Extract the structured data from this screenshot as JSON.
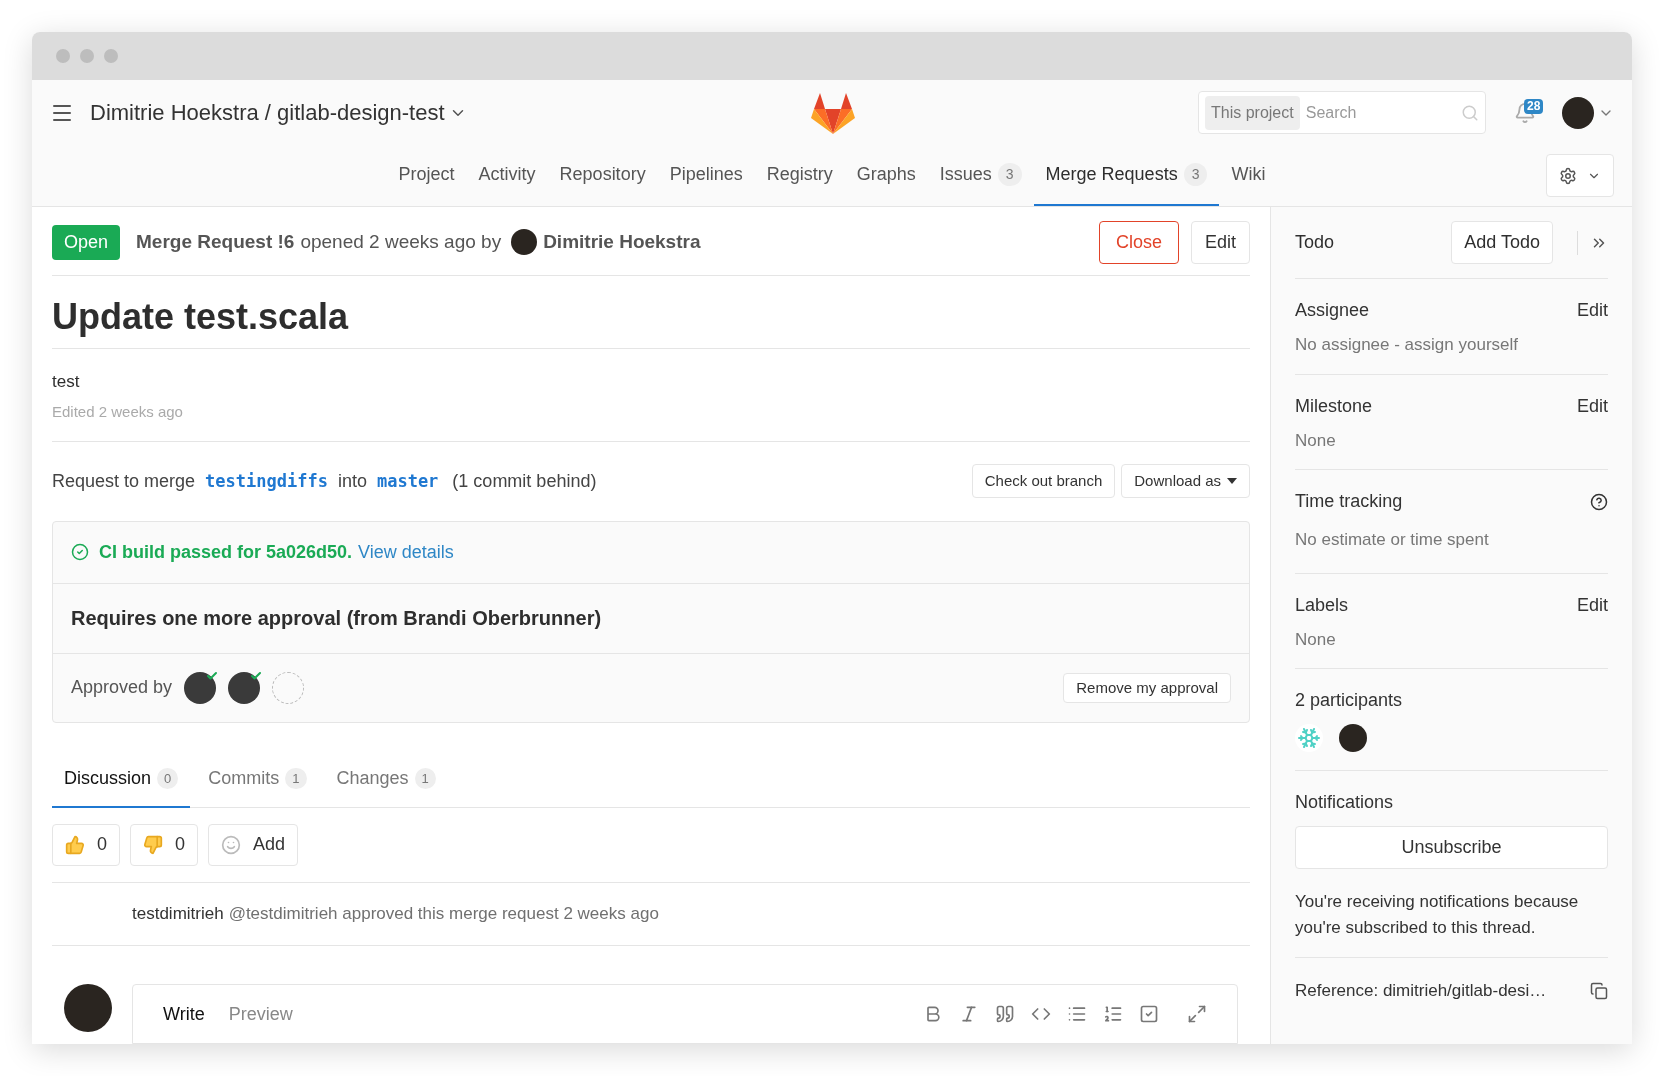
{
  "header": {
    "project_path": "Dimitrie Hoekstra / gitlab-design-test",
    "search": {
      "scope": "This project",
      "placeholder": "Search"
    },
    "notifications_count": "28"
  },
  "nav": [
    {
      "label": "Project",
      "selected": false
    },
    {
      "label": "Activity",
      "selected": false
    },
    {
      "label": "Repository",
      "selected": false
    },
    {
      "label": "Pipelines",
      "selected": false
    },
    {
      "label": "Registry",
      "selected": false
    },
    {
      "label": "Graphs",
      "selected": false
    },
    {
      "label": "Issues",
      "count": "3",
      "selected": false
    },
    {
      "label": "Merge Requests",
      "count": "3",
      "selected": true
    },
    {
      "label": "Wiki",
      "selected": false
    }
  ],
  "merge_request": {
    "status": "Open",
    "ref": "Merge Request !6",
    "opened_text": "opened 2 weeks ago by",
    "author": "Dimitrie Hoekstra",
    "close_button": "Close",
    "edit_button": "Edit",
    "title": "Update test.scala",
    "description": "test",
    "edited": "Edited 2 weeks ago"
  },
  "branch_info": {
    "prefix": "Request to merge",
    "source": "testingdiffs",
    "into": "into",
    "target": "master",
    "behind": "(1 commit behind)",
    "checkout_button": "Check out branch",
    "download_button": "Download as"
  },
  "ci": {
    "status_text": "CI build passed for 5a026d50.",
    "link": "View details"
  },
  "approvals": {
    "requirement": "Requires one more approval (from Brandi Oberbrunner)",
    "label": "Approved by",
    "approvers": [
      {
        "approved": true
      },
      {
        "approved": true
      },
      {
        "approved": false
      }
    ],
    "button": "Remove my approval"
  },
  "tabs": [
    {
      "label": "Discussion",
      "count": "0",
      "selected": true
    },
    {
      "label": "Commits",
      "count": "1",
      "selected": false
    },
    {
      "label": "Changes",
      "count": "1",
      "selected": false
    }
  ],
  "reactions": [
    {
      "kind": "thumbs_up",
      "text": "0"
    },
    {
      "kind": "thumbs_down",
      "text": "0"
    },
    {
      "kind": "add",
      "text": "Add"
    }
  ],
  "activity": [
    {
      "user": "testdimitrieh",
      "text": "@testdimitrieh approved this merge request 2 weeks ago"
    }
  ],
  "editor": {
    "tabs": [
      {
        "label": "Write",
        "selected": true
      },
      {
        "label": "Preview",
        "selected": false
      }
    ]
  },
  "sidebar": {
    "todo": {
      "label": "Todo",
      "button": "Add Todo"
    },
    "sections": [
      {
        "kind": "edit",
        "title": "Assignee",
        "action": "Edit",
        "value": "No assignee - assign yourself"
      },
      {
        "kind": "edit",
        "title": "Milestone",
        "action": "Edit",
        "value": "None"
      },
      {
        "kind": "help",
        "title": "Time tracking",
        "value": "No estimate or time spent"
      },
      {
        "kind": "edit",
        "title": "Labels",
        "action": "Edit",
        "value": "None"
      }
    ],
    "participants": {
      "title": "2 participants",
      "people": [
        {
          "kind": "identicon"
        },
        {
          "kind": "photo"
        }
      ]
    },
    "notifications": {
      "title": "Notifications",
      "button": "Unsubscribe",
      "note": "You're receiving notifications because you're subscribed to this thread."
    },
    "reference": "Reference: dimitrieh/gitlab-desi…"
  }
}
